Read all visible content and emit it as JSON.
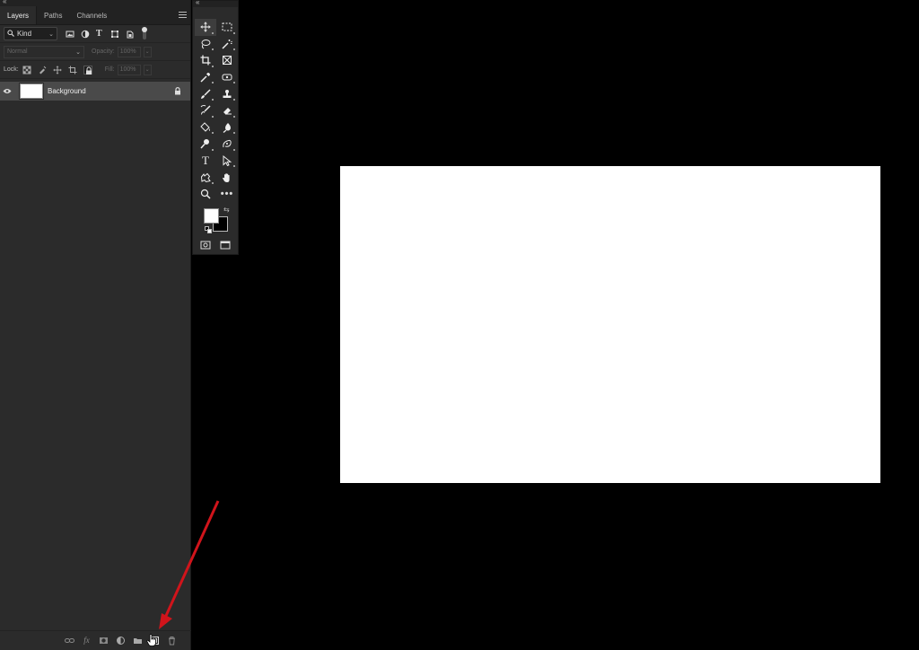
{
  "layers_panel": {
    "tabs": [
      {
        "label": "Layers"
      },
      {
        "label": "Paths"
      },
      {
        "label": "Channels"
      }
    ],
    "filter_kind": "Kind",
    "blend_mode": "Normal",
    "opacity_label": "Opacity:",
    "opacity_value": "100%",
    "lock_label": "Lock:",
    "fill_label": "Fill:",
    "fill_value": "100%",
    "layers": [
      {
        "name": "Background",
        "visible": true,
        "locked": true
      }
    ]
  },
  "icons": {
    "filter": [
      "search-icon",
      "image-filter-icon",
      "adjustment-filter-icon",
      "type-filter-icon",
      "shape-filter-icon",
      "smart-object-filter-icon"
    ],
    "lock": [
      "lock-transparent-pixels-icon",
      "lock-image-pixels-icon",
      "lock-position-icon",
      "lock-artboard-icon",
      "lock-all-icon"
    ],
    "footer": [
      "link-layers-icon",
      "fx-icon",
      "layer-mask-icon",
      "adjustment-layer-icon",
      "new-group-icon",
      "new-layer-icon",
      "delete-layer-icon"
    ],
    "tools": [
      "move-tool-icon",
      "rectangular-marquee-icon",
      "lasso-tool-icon",
      "magic-wand-icon",
      "crop-tool-icon",
      "frame-tool-icon",
      "eyedropper-icon",
      "spot-healing-icon",
      "brush-tool-icon",
      "clone-stamp-icon",
      "history-brush-icon",
      "eraser-tool-icon",
      "paint-bucket-icon",
      "blur-tool-icon",
      "dodge-tool-icon",
      "pen-tool-icon",
      "type-tool-icon",
      "path-selection-icon",
      "custom-shape-icon",
      "hand-tool-icon",
      "zoom-tool-icon",
      "more-tools-icon"
    ]
  },
  "toolbar": {
    "text_tool_glyph": "T",
    "more_glyph": "•••",
    "foreground_color": "#ffffff",
    "background_color": "#000000"
  },
  "canvas": {
    "background": "#ffffff"
  },
  "annotation": {
    "arrow_color": "#d0141b"
  }
}
